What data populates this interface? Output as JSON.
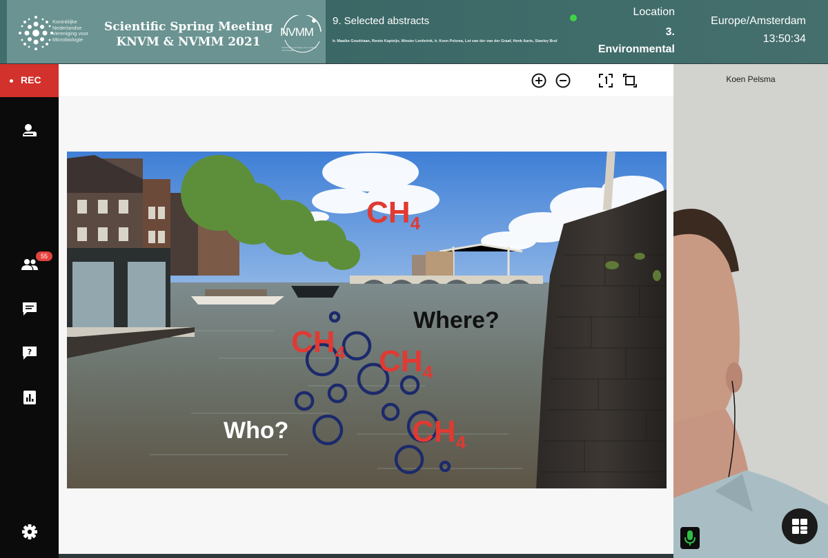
{
  "header": {
    "society_text": "Koninklijke Nederlandse Vereniging voor Microbiologie",
    "event_title_line1": "Scientific Spring Meeting",
    "event_title_line2": "KNVM & NVMM 2021",
    "partner_logo": "NVMM",
    "partner_logo_sub": "nederlandse vereniging voor medische microbiologie",
    "session_title": "9. Selected abstracts",
    "authors": "Ir. Maaike Goudriaan, Renée Kapteijn, Wouter Lenferink, Ir. Koen Pelsma, Lot van der van der Graaf, Henk Aarts, Stanley Brul",
    "location_label": "Location",
    "location_value_line1": "3.",
    "location_value_line2": "Environmental",
    "timezone": "Europe/Amsterdam",
    "time": "13:50:34",
    "live_indicator_color": "#3fd346"
  },
  "sidebar": {
    "rec_label": "REC",
    "participants_count": "55",
    "items": [
      {
        "icon": "presenter-icon"
      },
      {
        "icon": "participants-icon"
      },
      {
        "icon": "chat-icon"
      },
      {
        "icon": "question-icon"
      },
      {
        "icon": "poll-icon"
      },
      {
        "icon": "settings-icon"
      }
    ],
    "accent_color": "#d3312b"
  },
  "toolbar": {
    "tools": [
      "zoom-in-icon",
      "zoom-out-icon",
      "fit-actual-size-icon",
      "fit-window-icon"
    ]
  },
  "slide": {
    "labels": {
      "ch4_sky": "CH",
      "ch4_water_left": "CH",
      "ch4_water_mid": "CH",
      "ch4_water_right": "CH",
      "subscript": "4",
      "where": "Where?",
      "who": "Who?"
    },
    "colors": {
      "ch4": "#e03a32",
      "bubbles": "#1c2a6b"
    }
  },
  "video": {
    "speaker_name": "Koen Pelsma"
  }
}
